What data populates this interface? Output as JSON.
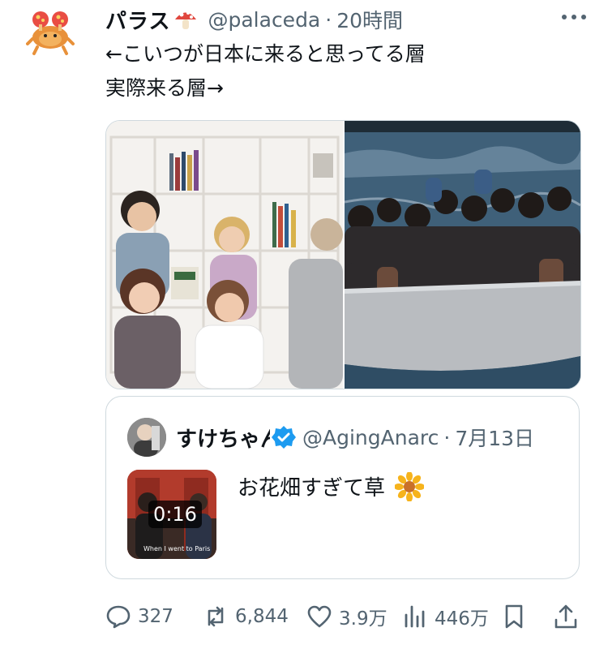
{
  "tweet": {
    "display_name": "パラス",
    "handle": "@palaceda",
    "separator": "·",
    "timestamp": "20時間",
    "text_line1": "←こいつが日本に来ると思ってる層",
    "text_line2": "実際来る層→"
  },
  "quoted_tweet": {
    "display_name": "すけちゃん",
    "handle": "@AgingAnarc",
    "separator": "·",
    "date": "7月13日",
    "video_duration": "0:16",
    "video_caption": "When I went to Paris",
    "text": "お花畑すぎて草"
  },
  "actions": {
    "replies": "327",
    "retweets": "6,844",
    "likes": "3.9万",
    "views": "446万"
  },
  "icons": {
    "avatar": "paras-avatar-icon",
    "mushroom": "mushroom-icon",
    "more": "more-icon",
    "verified": "verified-badge-icon",
    "sunflower": "sunflower-icon",
    "reply": "reply-icon",
    "retweet": "retweet-icon",
    "like": "like-icon",
    "views": "views-icon",
    "bookmark": "bookmark-icon",
    "share": "share-icon"
  },
  "colors": {
    "text": "#0f1419",
    "secondary": "#536471",
    "border": "#cfd9de",
    "verified": "#1d9bf0"
  }
}
